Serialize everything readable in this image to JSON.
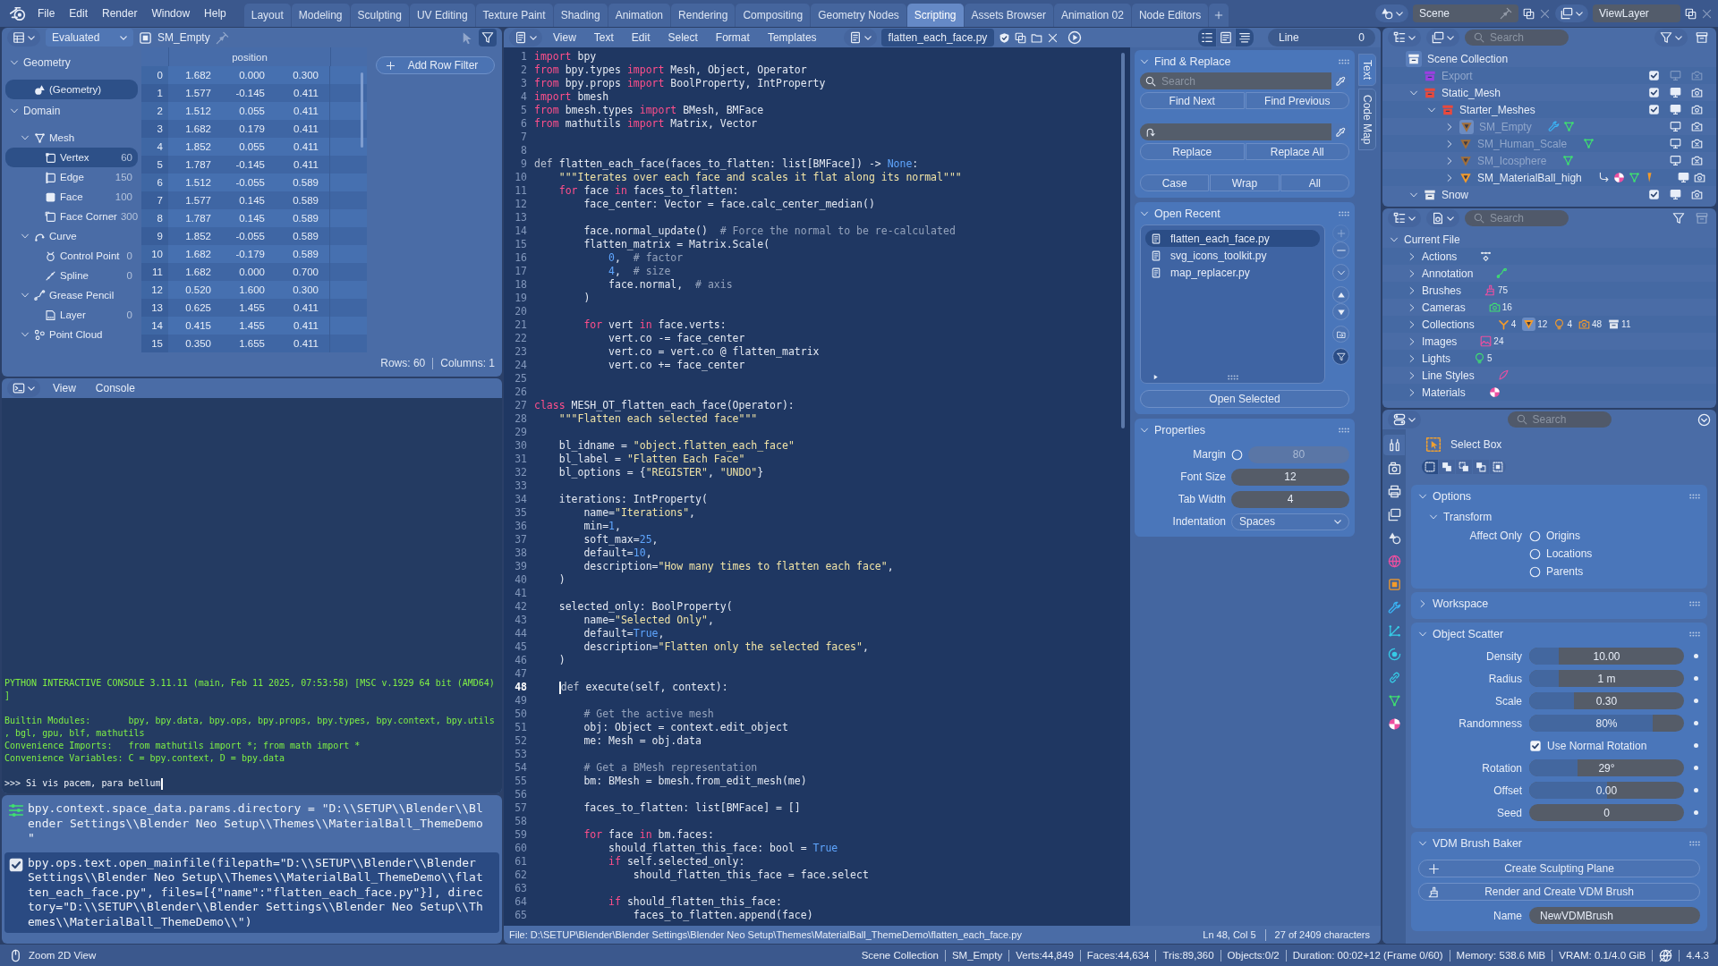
{
  "top_bar": {
    "menus": [
      "File",
      "Edit",
      "Render",
      "Window",
      "Help"
    ],
    "workspaces": [
      {
        "label": "Layout",
        "selected": false
      },
      {
        "label": "Modeling",
        "selected": false
      },
      {
        "label": "Sculpting",
        "selected": false
      },
      {
        "label": "UV Editing",
        "selected": false
      },
      {
        "label": "Texture Paint",
        "selected": false
      },
      {
        "label": "Shading",
        "selected": false
      },
      {
        "label": "Animation",
        "selected": false
      },
      {
        "label": "Rendering",
        "selected": false
      },
      {
        "label": "Compositing",
        "selected": false
      },
      {
        "label": "Geometry Nodes",
        "selected": false
      },
      {
        "label": "Scripting",
        "selected": true
      },
      {
        "label": "Assets Browser",
        "selected": false
      },
      {
        "label": "Animation 02",
        "selected": false
      },
      {
        "label": "Node Editors",
        "selected": false
      }
    ],
    "scene": "Scene",
    "view_layer": "ViewLayer"
  },
  "spreadsheet": {
    "evaluation": "Evaluated",
    "object": "SM_Empty",
    "tree": [
      {
        "kind": "section",
        "label": "Geometry",
        "expanded": true,
        "children": [
          {
            "kind": "geometry",
            "label": "(Geometry)",
            "selected": true
          }
        ]
      },
      {
        "kind": "section",
        "label": "Domain",
        "expanded": true,
        "children": [
          {
            "kind": "mesh",
            "label": "Mesh",
            "expanded": true,
            "selected": false,
            "children": [
              {
                "kind": "vertex",
                "label": "Vertex",
                "count": "60",
                "selected": true
              },
              {
                "kind": "edge",
                "label": "Edge",
                "count": "150",
                "selected": false
              },
              {
                "kind": "face",
                "label": "Face",
                "count": "100",
                "selected": false
              },
              {
                "kind": "corner",
                "label": "Face Corner",
                "count": "300",
                "selected": false
              }
            ]
          },
          {
            "kind": "curve",
            "label": "Curve",
            "expanded": true,
            "selected": false,
            "children": [
              {
                "kind": "control_point",
                "label": "Control Point",
                "count": "0",
                "selected": false
              },
              {
                "kind": "spline",
                "label": "Spline",
                "count": "0",
                "selected": false
              }
            ]
          },
          {
            "kind": "grease_pencil",
            "label": "Grease Pencil",
            "expanded": true,
            "selected": false,
            "children": [
              {
                "kind": "layer",
                "label": "Layer",
                "count": "0",
                "selected": false
              }
            ]
          },
          {
            "kind": "point_cloud",
            "label": "Point Cloud",
            "expanded": true,
            "selected": false
          }
        ]
      }
    ],
    "table": {
      "columns": [
        "position"
      ],
      "rows": [
        {
          "index": "0",
          "values": [
            "1.682",
            "0.000",
            "0.300"
          ]
        },
        {
          "index": "1",
          "values": [
            "1.577",
            "-0.145",
            "0.411"
          ]
        },
        {
          "index": "2",
          "values": [
            "1.512",
            "0.055",
            "0.411"
          ]
        },
        {
          "index": "3",
          "values": [
            "1.682",
            "0.179",
            "0.411"
          ]
        },
        {
          "index": "4",
          "values": [
            "1.852",
            "0.055",
            "0.411"
          ]
        },
        {
          "index": "5",
          "values": [
            "1.787",
            "-0.145",
            "0.411"
          ]
        },
        {
          "index": "6",
          "values": [
            "1.512",
            "-0.055",
            "0.589"
          ]
        },
        {
          "index": "7",
          "values": [
            "1.577",
            "0.145",
            "0.589"
          ]
        },
        {
          "index": "8",
          "values": [
            "1.787",
            "0.145",
            "0.589"
          ]
        },
        {
          "index": "9",
          "values": [
            "1.852",
            "-0.055",
            "0.589"
          ]
        },
        {
          "index": "10",
          "values": [
            "1.682",
            "-0.179",
            "0.589"
          ]
        },
        {
          "index": "11",
          "values": [
            "1.682",
            "0.000",
            "0.700"
          ]
        },
        {
          "index": "12",
          "values": [
            "0.520",
            "1.600",
            "0.300"
          ]
        },
        {
          "index": "13",
          "values": [
            "0.625",
            "1.455",
            "0.411"
          ]
        },
        {
          "index": "14",
          "values": [
            "0.415",
            "1.455",
            "0.411"
          ]
        },
        {
          "index": "15",
          "values": [
            "0.350",
            "1.655",
            "0.411"
          ]
        }
      ]
    },
    "add_filter": "Add Row Filter",
    "rows_info": "Rows: 60",
    "columns_info": "Columns: 1"
  },
  "console": {
    "menus": [
      "View",
      "Console"
    ],
    "blocks": [
      [
        "PYTHON INTERACTIVE CONSOLE 3.11.11 (main, Feb 11 2025, 07:53:58) [MSC v.1929 64 bit (AMD64)",
        "]"
      ],
      [
        "Builtin Modules:       bpy, bpy.data, bpy.ops, bpy.props, bpy.types, bpy.context, bpy.utils",
        ", bgl, gpu, blf, mathutils",
        "Convenience Imports:   from mathutils import *; from math import *",
        "Convenience Variables: C = bpy.context, D = bpy.data"
      ]
    ],
    "prompt": ">>>",
    "input": "Si vis pacem, para bellum"
  },
  "info_log": [
    {
      "kind": "property",
      "selected": false,
      "text": "bpy.context.space_data.params.directory = \"D:\\\\SETUP\\\\Blender\\\\Blender Settings\\\\Blender Neo Setup\\\\Themes\\\\MaterialBall_ThemeDemo\""
    },
    {
      "kind": "operator",
      "selected": true,
      "text": "bpy.ops.text.open_mainfile(filepath=\"D:\\\\SETUP\\\\Blender\\\\Blender Settings\\\\Blender Neo Setup\\\\Themes\\\\MaterialBall_ThemeDemo\\\\flatten_each_face.py\", files=[{\"name\":\"flatten_each_face.py\"}], directory=\"D:\\\\SETUP\\\\Blender\\\\Blender Settings\\\\Blender Neo Setup\\\\Themes\\\\MaterialBall_ThemeDemo\\\\\")"
    }
  ],
  "text_editor": {
    "menus": [
      "View",
      "Text",
      "Edit",
      "Select",
      "Format",
      "Templates"
    ],
    "file_name": "flatten_each_face.py",
    "line_label": "Line",
    "line_value": "0",
    "lines": [
      {
        "number": "1",
        "selected": false,
        "code": [
          {
            "kind": "keyword",
            "text": "import"
          },
          {
            "kind": "plain",
            "text": " bpy"
          }
        ]
      },
      {
        "number": "2",
        "selected": false,
        "code": [
          {
            "kind": "keyword",
            "text": "from"
          },
          {
            "kind": "plain",
            "text": " bpy.types "
          },
          {
            "kind": "keyword",
            "text": "import"
          },
          {
            "kind": "plain",
            "text": " Mesh, Object, Operator"
          }
        ]
      },
      {
        "number": "3",
        "selected": false,
        "code": [
          {
            "kind": "keyword",
            "text": "from"
          },
          {
            "kind": "plain",
            "text": " bpy.props "
          },
          {
            "kind": "keyword",
            "text": "import"
          },
          {
            "kind": "plain",
            "text": " BoolProperty, IntProperty"
          }
        ]
      },
      {
        "number": "4",
        "selected": false,
        "code": [
          {
            "kind": "keyword",
            "text": "import"
          },
          {
            "kind": "plain",
            "text": " bmesh"
          }
        ]
      },
      {
        "number": "5",
        "selected": false,
        "code": [
          {
            "kind": "keyword",
            "text": "from"
          },
          {
            "kind": "plain",
            "text": " bmesh.types "
          },
          {
            "kind": "keyword",
            "text": "import"
          },
          {
            "kind": "plain",
            "text": " BMesh, BMFace"
          }
        ]
      },
      {
        "number": "6",
        "selected": false,
        "code": [
          {
            "kind": "keyword",
            "text": "from"
          },
          {
            "kind": "plain",
            "text": " mathutils "
          },
          {
            "kind": "keyword",
            "text": "import"
          },
          {
            "kind": "plain",
            "text": " Matrix, Vector"
          }
        ]
      },
      {
        "number": "7",
        "selected": false
      },
      {
        "number": "8",
        "selected": false
      },
      {
        "number": "9",
        "selected": false,
        "code": [
          {
            "kind": "def",
            "text": "def"
          },
          {
            "kind": "plain",
            "text": " flatten_each_face(faces_to_flatten: list[BMFace]) -> "
          },
          {
            "kind": "number",
            "text": "None"
          },
          {
            "kind": "plain",
            "text": ":"
          }
        ]
      },
      {
        "number": "10",
        "selected": false,
        "code": [
          {
            "kind": "string",
            "text": "    \"\"\"Iterates over each face and scales it flat along its normal\"\"\""
          }
        ]
      },
      {
        "number": "11",
        "selected": false,
        "code": [
          {
            "kind": "keyword",
            "text": "    for"
          },
          {
            "kind": "plain",
            "text": " face "
          },
          {
            "kind": "keyword",
            "text": "in"
          },
          {
            "kind": "plain",
            "text": " faces_to_flatten:"
          }
        ]
      },
      {
        "number": "12",
        "selected": false,
        "code": [
          {
            "kind": "plain",
            "text": "        face_center: Vector = face.calc_center_median()"
          }
        ]
      },
      {
        "number": "13",
        "selected": false
      },
      {
        "number": "14",
        "selected": false,
        "code": [
          {
            "kind": "plain",
            "text": "        face.normal_update()  "
          },
          {
            "kind": "comment",
            "text": "# Force the normal to be re-calculated"
          }
        ]
      },
      {
        "number": "15",
        "selected": false,
        "code": [
          {
            "kind": "plain",
            "text": "        flatten_matrix = Matrix.Scale("
          }
        ]
      },
      {
        "number": "16",
        "selected": false,
        "code": [
          {
            "kind": "number",
            "text": "            0"
          },
          {
            "kind": "plain",
            "text": ",  "
          },
          {
            "kind": "comment",
            "text": "# factor"
          }
        ]
      },
      {
        "number": "17",
        "selected": false,
        "code": [
          {
            "kind": "number",
            "text": "            4"
          },
          {
            "kind": "plain",
            "text": ",  "
          },
          {
            "kind": "comment",
            "text": "# size"
          }
        ]
      },
      {
        "number": "18",
        "selected": false,
        "code": [
          {
            "kind": "plain",
            "text": "            face.normal,  "
          },
          {
            "kind": "comment",
            "text": "# axis"
          }
        ]
      },
      {
        "number": "19",
        "selected": false,
        "code": [
          {
            "kind": "plain",
            "text": "        )"
          }
        ]
      },
      {
        "number": "20",
        "selected": false
      },
      {
        "number": "21",
        "selected": false,
        "code": [
          {
            "kind": "keyword",
            "text": "        for"
          },
          {
            "kind": "plain",
            "text": " vert "
          },
          {
            "kind": "keyword",
            "text": "in"
          },
          {
            "kind": "plain",
            "text": " face.verts:"
          }
        ]
      },
      {
        "number": "22",
        "selected": false,
        "code": [
          {
            "kind": "plain",
            "text": "            vert.co -= face_center"
          }
        ]
      },
      {
        "number": "23",
        "selected": false,
        "code": [
          {
            "kind": "plain",
            "text": "            vert.co = vert.co @ flatten_matrix"
          }
        ]
      },
      {
        "number": "24",
        "selected": false,
        "code": [
          {
            "kind": "plain",
            "text": "            vert.co += face_center"
          }
        ]
      },
      {
        "number": "25",
        "selected": false
      },
      {
        "number": "26",
        "selected": false
      },
      {
        "number": "27",
        "selected": false,
        "code": [
          {
            "kind": "keyword",
            "text": "class"
          },
          {
            "kind": "plain",
            "text": " MESH_OT_flatten_each_face(Operator):"
          }
        ]
      },
      {
        "number": "28",
        "selected": false,
        "code": [
          {
            "kind": "string",
            "text": "    \"\"\"Flatten each selected face\"\"\""
          }
        ]
      },
      {
        "number": "29",
        "selected": false
      },
      {
        "number": "30",
        "selected": false,
        "code": [
          {
            "kind": "plain",
            "text": "    bl_idname = "
          },
          {
            "kind": "string",
            "text": "\"object.flatten_each_face\""
          }
        ]
      },
      {
        "number": "31",
        "selected": false,
        "code": [
          {
            "kind": "plain",
            "text": "    bl_label = "
          },
          {
            "kind": "string",
            "text": "\"Flatten Each Face\""
          }
        ]
      },
      {
        "number": "32",
        "selected": false,
        "code": [
          {
            "kind": "plain",
            "text": "    bl_options = {"
          },
          {
            "kind": "string",
            "text": "\"REGISTER\""
          },
          {
            "kind": "plain",
            "text": ", "
          },
          {
            "kind": "string",
            "text": "\"UNDO\""
          },
          {
            "kind": "plain",
            "text": "}"
          }
        ]
      },
      {
        "number": "33",
        "selected": false
      },
      {
        "number": "34",
        "selected": false,
        "code": [
          {
            "kind": "plain",
            "text": "    iterations: IntProperty("
          }
        ]
      },
      {
        "number": "35",
        "selected": false,
        "code": [
          {
            "kind": "plain",
            "text": "        name="
          },
          {
            "kind": "string",
            "text": "\"Iterations\""
          },
          {
            "kind": "plain",
            "text": ","
          }
        ]
      },
      {
        "number": "36",
        "selected": false,
        "code": [
          {
            "kind": "plain",
            "text": "        min="
          },
          {
            "kind": "number",
            "text": "1"
          },
          {
            "kind": "plain",
            "text": ","
          }
        ]
      },
      {
        "number": "37",
        "selected": false,
        "code": [
          {
            "kind": "plain",
            "text": "        soft_max="
          },
          {
            "kind": "number",
            "text": "25"
          },
          {
            "kind": "plain",
            "text": ","
          }
        ]
      },
      {
        "number": "38",
        "selected": false,
        "code": [
          {
            "kind": "plain",
            "text": "        default="
          },
          {
            "kind": "number",
            "text": "10"
          },
          {
            "kind": "plain",
            "text": ","
          }
        ]
      },
      {
        "number": "39",
        "selected": false,
        "code": [
          {
            "kind": "plain",
            "text": "        description="
          },
          {
            "kind": "string",
            "text": "\"How many times to flatten each face\""
          },
          {
            "kind": "plain",
            "text": ","
          }
        ]
      },
      {
        "number": "40",
        "selected": false,
        "code": [
          {
            "kind": "plain",
            "text": "    )"
          }
        ]
      },
      {
        "number": "41",
        "selected": false
      },
      {
        "number": "42",
        "selected": false,
        "code": [
          {
            "kind": "plain",
            "text": "    selected_only: BoolProperty("
          }
        ]
      },
      {
        "number": "43",
        "selected": false,
        "code": [
          {
            "kind": "plain",
            "text": "        name="
          },
          {
            "kind": "string",
            "text": "\"Selected Only\""
          },
          {
            "kind": "plain",
            "text": ","
          }
        ]
      },
      {
        "number": "44",
        "selected": false,
        "code": [
          {
            "kind": "plain",
            "text": "        default="
          },
          {
            "kind": "number",
            "text": "True"
          },
          {
            "kind": "plain",
            "text": ","
          }
        ]
      },
      {
        "number": "45",
        "selected": false,
        "code": [
          {
            "kind": "plain",
            "text": "        description="
          },
          {
            "kind": "string",
            "text": "\"Flatten only the selected faces\""
          },
          {
            "kind": "plain",
            "text": ","
          }
        ]
      },
      {
        "number": "46",
        "selected": false,
        "code": [
          {
            "kind": "plain",
            "text": "    )"
          }
        ]
      },
      {
        "number": "47",
        "selected": false
      },
      {
        "number": "48",
        "selected": true,
        "code": [
          {
            "kind": "def",
            "text": "    def"
          },
          {
            "kind": "plain",
            "text": " execute(self, context):"
          }
        ]
      },
      {
        "number": "49",
        "selected": false
      },
      {
        "number": "50",
        "selected": false,
        "code": [
          {
            "kind": "comment",
            "text": "        # Get the active mesh"
          }
        ]
      },
      {
        "number": "51",
        "selected": false,
        "code": [
          {
            "kind": "plain",
            "text": "        obj: Object = context.edit_object"
          }
        ]
      },
      {
        "number": "52",
        "selected": false,
        "code": [
          {
            "kind": "plain",
            "text": "        me: Mesh = obj.data"
          }
        ]
      },
      {
        "number": "53",
        "selected": false
      },
      {
        "number": "54",
        "selected": false,
        "code": [
          {
            "kind": "comment",
            "text": "        # Get a BMesh representation"
          }
        ]
      },
      {
        "number": "55",
        "selected": false,
        "code": [
          {
            "kind": "plain",
            "text": "        bm: BMesh = bmesh.from_edit_mesh(me)"
          }
        ]
      },
      {
        "number": "56",
        "selected": false
      },
      {
        "number": "57",
        "selected": false,
        "code": [
          {
            "kind": "plain",
            "text": "        faces_to_flatten: list[BMFace] = []"
          }
        ]
      },
      {
        "number": "58",
        "selected": false
      },
      {
        "number": "59",
        "selected": false,
        "code": [
          {
            "kind": "keyword",
            "text": "        for"
          },
          {
            "kind": "plain",
            "text": " face "
          },
          {
            "kind": "keyword",
            "text": "in"
          },
          {
            "kind": "plain",
            "text": " bm.faces:"
          }
        ]
      },
      {
        "number": "60",
        "selected": false,
        "code": [
          {
            "kind": "plain",
            "text": "            should_flatten_this_face: bool = "
          },
          {
            "kind": "number",
            "text": "True"
          }
        ]
      },
      {
        "number": "61",
        "selected": false,
        "code": [
          {
            "kind": "keyword",
            "text": "            if"
          },
          {
            "kind": "plain",
            "text": " self.selected_only:"
          }
        ]
      },
      {
        "number": "62",
        "selected": false,
        "code": [
          {
            "kind": "plain",
            "text": "                should_flatten_this_face = face.select"
          }
        ]
      },
      {
        "number": "63",
        "selected": false
      },
      {
        "number": "64",
        "selected": false,
        "code": [
          {
            "kind": "keyword",
            "text": "            if"
          },
          {
            "kind": "plain",
            "text": " should_flatten_this_face:"
          }
        ]
      },
      {
        "number": "65",
        "selected": false,
        "code": [
          {
            "kind": "plain",
            "text": "                faces_to_flatten.append(face)"
          }
        ]
      }
    ],
    "footer": {
      "path": "File: D:\\SETUP\\Blender\\Blender Settings\\Blender Neo Setup\\Themes\\MaterialBall_ThemeDemo\\flatten_each_face.py",
      "position": "Ln 48, Col 5",
      "count": "27 of 2409 characters"
    }
  },
  "sidebar": {
    "tabs": [
      {
        "label": "Text",
        "selected": true
      },
      {
        "label": "Code Map",
        "selected": false
      }
    ],
    "find_replace": {
      "title": "Find & Replace",
      "expanded": true,
      "search_placeholder": "Search",
      "find_buttons": [
        "Find Next",
        "Find Previous"
      ],
      "replace_buttons": [
        "Replace",
        "Replace All"
      ],
      "options": [
        {
          "label": "Case",
          "on": false
        },
        {
          "label": "Wrap",
          "on": false
        },
        {
          "label": "All",
          "on": false
        }
      ]
    },
    "open_recent": {
      "title": "Open Recent",
      "expanded": true,
      "files": [
        {
          "name": "flatten_each_face.py",
          "selected": true
        },
        {
          "name": "svg_icons_toolkit.py",
          "selected": false
        },
        {
          "name": "map_replacer.py",
          "selected": false
        }
      ],
      "button": "Open Selected"
    },
    "properties": {
      "title": "Properties",
      "expanded": true,
      "fields": [
        {
          "kind": "toggle_number",
          "label": "Margin",
          "value": "80",
          "checked": false
        },
        {
          "kind": "number",
          "label": "Font Size",
          "value": "12"
        },
        {
          "kind": "number",
          "label": "Tab Width",
          "value": "4"
        },
        {
          "kind": "dropdown",
          "label": "Indentation",
          "value": "Spaces"
        }
      ]
    }
  },
  "outliner": {
    "search_placeholder": "Search",
    "tree": [
      {
        "kind": "scene",
        "label": "Scene Collection",
        "children": [
          {
            "kind": "collection",
            "label": "Export",
            "color": "#9b3fe0",
            "checked": true,
            "visible": false,
            "renderable": false
          },
          {
            "kind": "collection",
            "label": "Static_Mesh",
            "color": "#e8493d",
            "expanded": true,
            "checked": true,
            "visible": true,
            "renderable": true,
            "children": [
              {
                "kind": "collection",
                "label": "Starter_Meshes",
                "color": "#e8493d",
                "expanded": true,
                "checked": true,
                "visible": true,
                "renderable": true,
                "children": [
                  {
                    "kind": "object",
                    "label": "SM_Empty",
                    "expanded": false,
                    "active": true,
                    "visible": false,
                    "renderable": false,
                    "badges": [
                      {
                        "kind": "modifier"
                      },
                      {
                        "kind": "mesh"
                      }
                    ]
                  },
                  {
                    "kind": "object",
                    "label": "SM_Human_Scale",
                    "expanded": false,
                    "active": false,
                    "visible": false,
                    "renderable": false,
                    "badges": [
                      {
                        "kind": "mesh"
                      }
                    ]
                  },
                  {
                    "kind": "object",
                    "label": "SM_Icosphere",
                    "expanded": false,
                    "active": false,
                    "visible": false,
                    "renderable": false,
                    "badges": [
                      {
                        "kind": "mesh"
                      }
                    ]
                  },
                  {
                    "kind": "object",
                    "label": "SM_MaterialBall_high",
                    "expanded": false,
                    "active": false,
                    "visible": true,
                    "renderable": true,
                    "badges": [
                      {
                        "kind": "hook"
                      },
                      {
                        "kind": "material"
                      },
                      {
                        "kind": "mesh"
                      },
                      {
                        "kind": "bone"
                      }
                    ]
                  }
                ]
              }
            ]
          },
          {
            "kind": "collection",
            "label": "Snow",
            "color": "#e4e8ef",
            "expanded": true,
            "checked": true,
            "visible": true,
            "renderable": true
          }
        ]
      }
    ]
  },
  "blend_file": {
    "search_placeholder": "Search",
    "tree": [
      {
        "label": "Current File",
        "expanded": true,
        "children": [
          {
            "label": "Actions",
            "expanded": false,
            "badges": [
              {
                "kind": "action"
              }
            ]
          },
          {
            "label": "Annotation",
            "expanded": false,
            "badges": [
              {
                "kind": "annotation"
              }
            ]
          },
          {
            "label": "Brushes",
            "expanded": false,
            "badges": [
              {
                "kind": "brush",
                "count": "75"
              }
            ]
          },
          {
            "label": "Cameras",
            "expanded": false,
            "badges": [
              {
                "kind": "camera_data",
                "count": "16"
              }
            ]
          },
          {
            "label": "Collections",
            "expanded": false,
            "badges": [
              {
                "kind": "armature",
                "count": "4",
                "selected": false
              },
              {
                "kind": "mesh_object",
                "count": "12",
                "selected": true
              },
              {
                "kind": "light_object",
                "count": "4",
                "selected": false
              },
              {
                "kind": "camera_object",
                "count": "48",
                "selected": false
              },
              {
                "kind": "collection",
                "count": "11",
                "selected": false
              }
            ]
          },
          {
            "label": "Images",
            "expanded": false,
            "badges": [
              {
                "kind": "image",
                "count": "24"
              }
            ]
          },
          {
            "label": "Lights",
            "expanded": false,
            "badges": [
              {
                "kind": "light_data",
                "count": "5"
              }
            ]
          },
          {
            "label": "Line Styles",
            "expanded": false,
            "badges": [
              {
                "kind": "line_style"
              }
            ]
          },
          {
            "label": "Materials",
            "expanded": false,
            "badges": [
              {
                "kind": "material"
              }
            ]
          }
        ]
      }
    ]
  },
  "properties_editor": {
    "search_placeholder": "Search",
    "tabs": [
      {
        "kind": "tool",
        "selected": true
      },
      {
        "kind": "render",
        "selected": false
      },
      {
        "kind": "output",
        "selected": false
      },
      {
        "kind": "view_layer",
        "selected": false
      },
      {
        "kind": "scene",
        "selected": false
      },
      {
        "kind": "world",
        "selected": false
      },
      {
        "kind": "object",
        "selected": false
      },
      {
        "kind": "modifier",
        "selected": false
      },
      {
        "kind": "particles",
        "selected": false
      },
      {
        "kind": "physics",
        "selected": false
      },
      {
        "kind": "constraints",
        "selected": false
      },
      {
        "kind": "data",
        "selected": false
      },
      {
        "kind": "material",
        "selected": false
      }
    ],
    "tool": {
      "name": "Select Box",
      "modes": [
        {
          "kind": "set",
          "selected": true
        },
        {
          "kind": "extend",
          "selected": false
        },
        {
          "kind": "subtract",
          "selected": false
        },
        {
          "kind": "invert",
          "selected": false
        },
        {
          "kind": "intersect",
          "selected": false
        }
      ]
    },
    "panels": [
      {
        "kind": "options",
        "title": "Options",
        "expanded": true,
        "subpanel": {
          "title": "Transform",
          "expanded": true,
          "label": "Affect Only",
          "choices": [
            {
              "label": "Origins",
              "checked": false
            },
            {
              "label": "Locations",
              "checked": false
            },
            {
              "label": "Parents",
              "checked": false
            }
          ]
        }
      },
      {
        "title": "Workspace",
        "expanded": false
      },
      {
        "kind": "fields",
        "title": "Object Scatter",
        "expanded": true,
        "fields": [
          {
            "kind": "slider",
            "label": "Density",
            "value": "10.00",
            "level": 0.19
          },
          {
            "kind": "slider",
            "label": "Radius",
            "value": "1 m",
            "level": 0.19
          },
          {
            "kind": "slider",
            "label": "Scale",
            "value": "0.30",
            "level": 0.29
          },
          {
            "kind": "slider",
            "label": "Randomness",
            "value": "80%",
            "level": 0.8
          },
          {
            "kind": "checkbox",
            "label": "Use Normal Rotation",
            "checked": true
          },
          {
            "kind": "slider",
            "label": "Rotation",
            "value": "29°",
            "level": 0.31
          },
          {
            "kind": "slider",
            "label": "Offset",
            "value": "0.00",
            "level": 0.5
          },
          {
            "kind": "number",
            "label": "Seed",
            "value": "0"
          }
        ]
      },
      {
        "kind": "actions",
        "title": "VDM Brush Baker",
        "expanded": true,
        "buttons": [
          {
            "kind": "add",
            "label": "Create Sculpting Plane"
          },
          {
            "kind": "brush",
            "label": "Render and Create VDM Brush"
          }
        ],
        "name_label": "Name",
        "name_value": "NewVDMBrush"
      }
    ]
  },
  "status_bar": {
    "hint": "Zoom 2D View",
    "stats": [
      "Scene Collection",
      "SM_Empty",
      "Verts:44,849",
      "Faces:44,634",
      "Tris:89,360",
      "Objects:0/2",
      "Duration: 00:02+12 (Frame 0/60)",
      "Memory: 538.6 MiB",
      "VRAM: 0.1/4.0 GiB"
    ],
    "version": "4.4.3"
  }
}
